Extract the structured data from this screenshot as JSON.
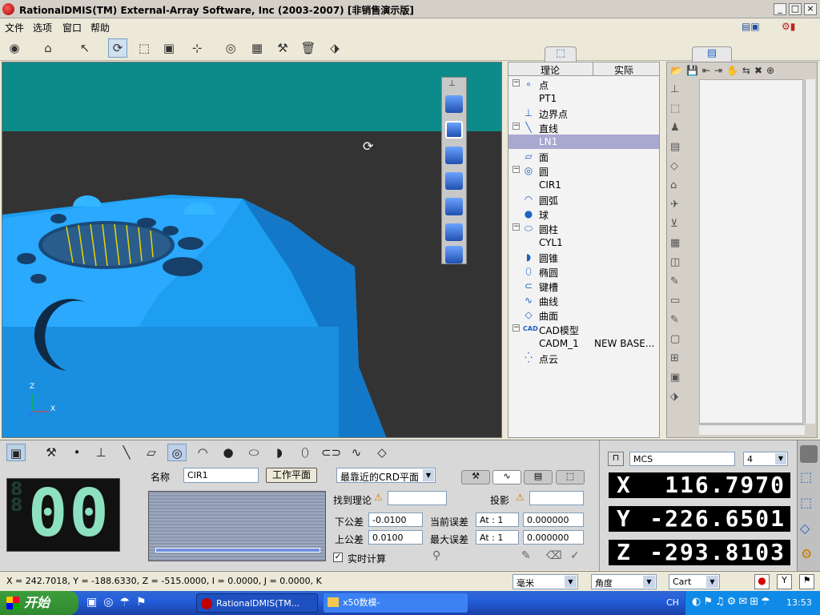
{
  "window": {
    "title": "RationalDMIS(TM) External-Array Software, Inc (2003-2007) [非销售演示版]"
  },
  "menu": [
    "文件",
    "选项",
    "窗口",
    "帮助"
  ],
  "tree": {
    "headers": [
      "理论",
      "实际"
    ],
    "items": [
      {
        "label": "点",
        "icon": "point-icon",
        "expand": "−"
      },
      {
        "label": "PT1",
        "icon": ""
      },
      {
        "label": "边界点",
        "icon": "edge-point-icon"
      },
      {
        "label": "直线",
        "icon": "line-icon",
        "expand": "−"
      },
      {
        "label": "LN1",
        "icon": "",
        "selected": true
      },
      {
        "label": "面",
        "icon": "plane-icon"
      },
      {
        "label": "圆",
        "icon": "circle-icon",
        "expand": "−"
      },
      {
        "label": "CIR1",
        "icon": ""
      },
      {
        "label": "圆弧",
        "icon": "arc-icon"
      },
      {
        "label": "球",
        "icon": "sphere-icon"
      },
      {
        "label": "圆柱",
        "icon": "cylinder-icon",
        "expand": "−"
      },
      {
        "label": "CYL1",
        "icon": ""
      },
      {
        "label": "圆锥",
        "icon": "cone-icon"
      },
      {
        "label": "椭圆",
        "icon": "ellipse-icon"
      },
      {
        "label": "键槽",
        "icon": "slot-icon"
      },
      {
        "label": "曲线",
        "icon": "curve-icon"
      },
      {
        "label": "曲面",
        "icon": "surface-icon"
      },
      {
        "label": "CAD模型",
        "icon": "cad-icon",
        "expand": "−"
      },
      {
        "label": "CADM_1",
        "icon": "",
        "value": "NEW BASE..."
      },
      {
        "label": "点云",
        "icon": "pointcloud-icon"
      }
    ]
  },
  "axes": {
    "z": "Z",
    "x": "X"
  },
  "bottom": {
    "counter": "00",
    "name_label": "名称",
    "name_value": "CIR1",
    "workplane_btn": "工作平面",
    "plane_select": "最靠近的CRD平面",
    "find_theory": "找到理论",
    "projection": "投影",
    "lower_tol_label": "下公差",
    "lower_tol": "-0.0100",
    "upper_tol_label": "上公差",
    "upper_tol": "0.0100",
    "cur_err_label": "当前误差",
    "cur_err_at": "At : 1",
    "cur_err_val": "0.000000",
    "max_err_label": "最大误差",
    "max_err_at": "At : 1",
    "max_err_val": "0.000000",
    "realtime": "实时计算"
  },
  "dro": {
    "system": "MCS",
    "decimals": "4",
    "x_label": "X",
    "x": "116.7970",
    "y_label": "Y",
    "y": "-226.6501",
    "z_label": "Z",
    "z": "-293.8103"
  },
  "status": {
    "coords": "X = 242.7018, Y = -188.6330, Z = -515.0000, I = 0.0000, J = 0.0000, K",
    "unit": "毫米",
    "angle": "角度",
    "coord_sys": "Cart"
  },
  "taskbar": {
    "start": "开始",
    "task1": "RationalDMIS(TM...",
    "task2": "x50数模-",
    "lang": "CH",
    "clock": "13:53"
  },
  "colors": {
    "viewport_bg": "#333333",
    "teal": "#0d8a8a",
    "part": "#1fa7ff",
    "selection": "#a8a8d0"
  }
}
